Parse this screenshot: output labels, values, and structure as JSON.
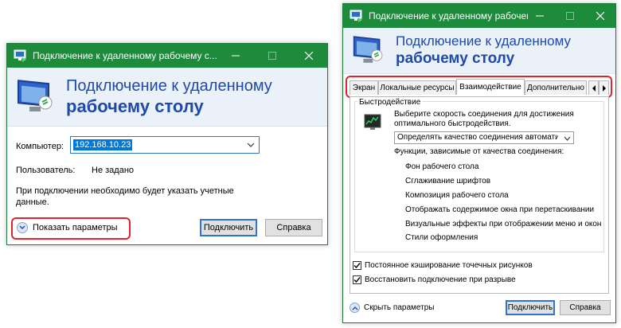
{
  "left": {
    "title": "Подключение к удаленному рабочему с...",
    "header_line1": "Подключение к удаленному",
    "header_line2": "рабочему столу",
    "computer_label": "Компьютер:",
    "computer_value": "192.168.10.23",
    "user_label": "Пользователь:",
    "user_value": "Не задано",
    "note": "При подключении необходимо будет указать учетные данные.",
    "show_options": "Показать параметры",
    "connect": "Подключить",
    "help": "Справка"
  },
  "right": {
    "title": "Подключение к удаленному рабочему с...",
    "header_line1": "Подключение к удаленному",
    "header_line2": "рабочему столу",
    "tabs": [
      "Экран",
      "Локальные ресурсы",
      "Взаимодействие",
      "Дополнительно"
    ],
    "active_tab": "Взаимодействие",
    "perf_group": "Быстродействие",
    "speed_desc": "Выберите скорость соединения для достижения оптимального быстродействия.",
    "speed_value": "Определять качество соединения автоматически",
    "features_label": "Функции, зависимые от качества соединения:",
    "features": [
      "Фон рабочего стола",
      "Сглаживание шрифтов",
      "Композиция рабочего стола",
      "Отображать содержимое окна при перетаскивании",
      "Визуальные эффекты при отображении меню и окон",
      "Стили оформления"
    ],
    "persistent_cache": "Постоянное кэширование точечных рисунков",
    "reconnect": "Восстановить подключение при разрыве",
    "hide_options": "Скрыть параметры",
    "connect": "Подключить",
    "help": "Справка"
  },
  "colors": {
    "titlebar": "#1e8a3c",
    "header_text": "#1f4aa8",
    "highlight": "#e0252e",
    "focus": "#2f74d0"
  }
}
